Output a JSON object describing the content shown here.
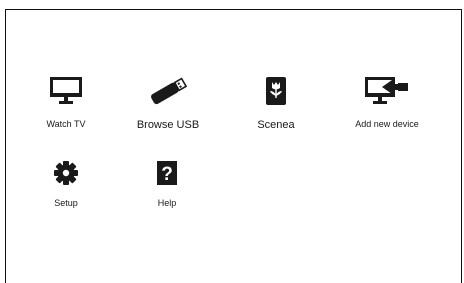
{
  "home_menu": {
    "items": [
      {
        "id": "watch_tv",
        "label": "Watch TV",
        "icon": "tv-icon"
      },
      {
        "id": "browse_usb",
        "label": "Browse USB",
        "icon": "usb-stick-icon"
      },
      {
        "id": "scenea",
        "label": "Scenea",
        "icon": "flower-icon"
      },
      {
        "id": "add_device",
        "label": "Add new device",
        "icon": "add-device-icon"
      },
      {
        "id": "setup",
        "label": "Setup",
        "icon": "gear-icon"
      },
      {
        "id": "help",
        "label": "Help",
        "icon": "help-icon"
      }
    ]
  },
  "colors": {
    "background": "#ffffff",
    "icon": "#1a1a1a",
    "border": "#111111"
  }
}
